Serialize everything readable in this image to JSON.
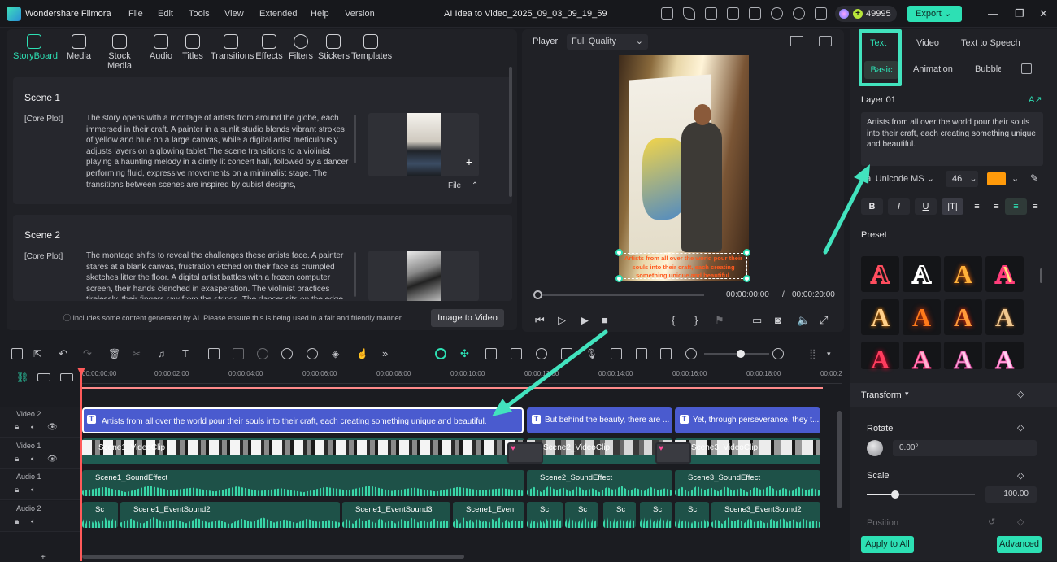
{
  "titlebar": {
    "app_name": "Wondershare Filmora",
    "menus": [
      "File",
      "Edit",
      "Tools",
      "View",
      "Extended",
      "Help",
      "Version"
    ],
    "project_title": "AI Idea to Video_2025_09_03_09_19_59",
    "credits": "49995",
    "export_label": "Export"
  },
  "media_tabs": [
    "StoryBoard",
    "Media",
    "Stock Media",
    "Audio",
    "Titles",
    "Transitions",
    "Effects",
    "Filters",
    "Stickers",
    "Templates"
  ],
  "scenes": [
    {
      "title": "Scene 1",
      "tag": "[Core Plot]",
      "text": "The story opens with a montage of artists from around the globe, each immersed in their craft. A painter in a sunlit studio blends vibrant strokes of yellow and blue on a large canvas, while a digital artist meticulously adjusts layers on a glowing tablet.The scene transitions to a violinist playing a haunting melody in a dimly lit concert hall, followed by a dancer performing fluid, expressive movements on a minimalist stage. The transitions between scenes are inspired by cubist designs,",
      "file_label": "File"
    },
    {
      "title": "Scene 2",
      "tag": "[Core Plot]",
      "text": "The montage shifts to reveal the challenges these artists face. A painter stares at a blank canvas, frustration etched on their face as crumpled sketches litter the floor. A digital artist battles with a frozen computer screen, their hands clenched in exasperation. The violinist practices tirelessly, their fingers raw from the strings. The dancer sits on the edge"
    }
  ],
  "disclaimer": "Includes some content generated by AI. Please ensure this is being used in a fair and friendly manner.",
  "image_to_video": "Image to Video",
  "player": {
    "label": "Player",
    "quality": "Full Quality",
    "caption": "Artists from all over the world pour their souls into their craft, each creating something unique and beautiful.",
    "current_time": "00:00:00:00",
    "separator": "/",
    "total_time": "00:00:20:00"
  },
  "right_panel": {
    "tabs": [
      "Text",
      "Video",
      "Text to Speech"
    ],
    "subtabs": [
      "Basic",
      "Animation",
      "Bubble"
    ],
    "layer": "Layer 01",
    "text_value": "Artists from all over the world pour their souls into their craft, each creating something unique and beautiful.",
    "font": "rial Unicode MS",
    "font_size": "46",
    "color": "#ff9a0a",
    "preset_label": "Preset",
    "transform_label": "Transform",
    "rotate_label": "Rotate",
    "rotate_value": "0.00°",
    "scale_label": "Scale",
    "scale_value": "100.00",
    "position_label": "Position",
    "apply_all": "Apply to All",
    "advanced": "Advanced"
  },
  "timeline": {
    "ruler": [
      "00:00:00:00",
      "00:00:02:00",
      "00:00:04:00",
      "00:00:06:00",
      "00:00:08:00",
      "00:00:10:00",
      "00:00:12:00",
      "00:00:14:00",
      "00:00:16:00",
      "00:00:18:00",
      "00:00:2"
    ],
    "tracks": [
      "Video 2",
      "Video 1",
      "Audio 1",
      "Audio 2"
    ],
    "text_clips": [
      "Artists from all over the world pour their souls into their craft, each creating something unique and beautiful.",
      "But behind the beauty, there are ...",
      "Yet, through perseverance, they t..."
    ],
    "video_clips": [
      "Scene1_VideoClip",
      "Scene2_VideoClip",
      "Scene3_VideoClip"
    ],
    "audio1_clips": [
      "Scene1_SoundEffect",
      "Scene2_SoundEffect",
      "Scene3_SoundEffect"
    ],
    "audio2_clips": [
      "Sc",
      "Scene1_EventSound2",
      "Scene1_EventSound3",
      "Scene1_Even",
      "Sc",
      "Sc",
      "Sc",
      "Sc",
      "Sc",
      "Scene3_EventSound2"
    ]
  },
  "colors": {
    "accent": "#2de0b4",
    "text_clip": "#4a5bcf",
    "audio_clip": "#1e5148",
    "playhead": "#ff5a5a"
  }
}
